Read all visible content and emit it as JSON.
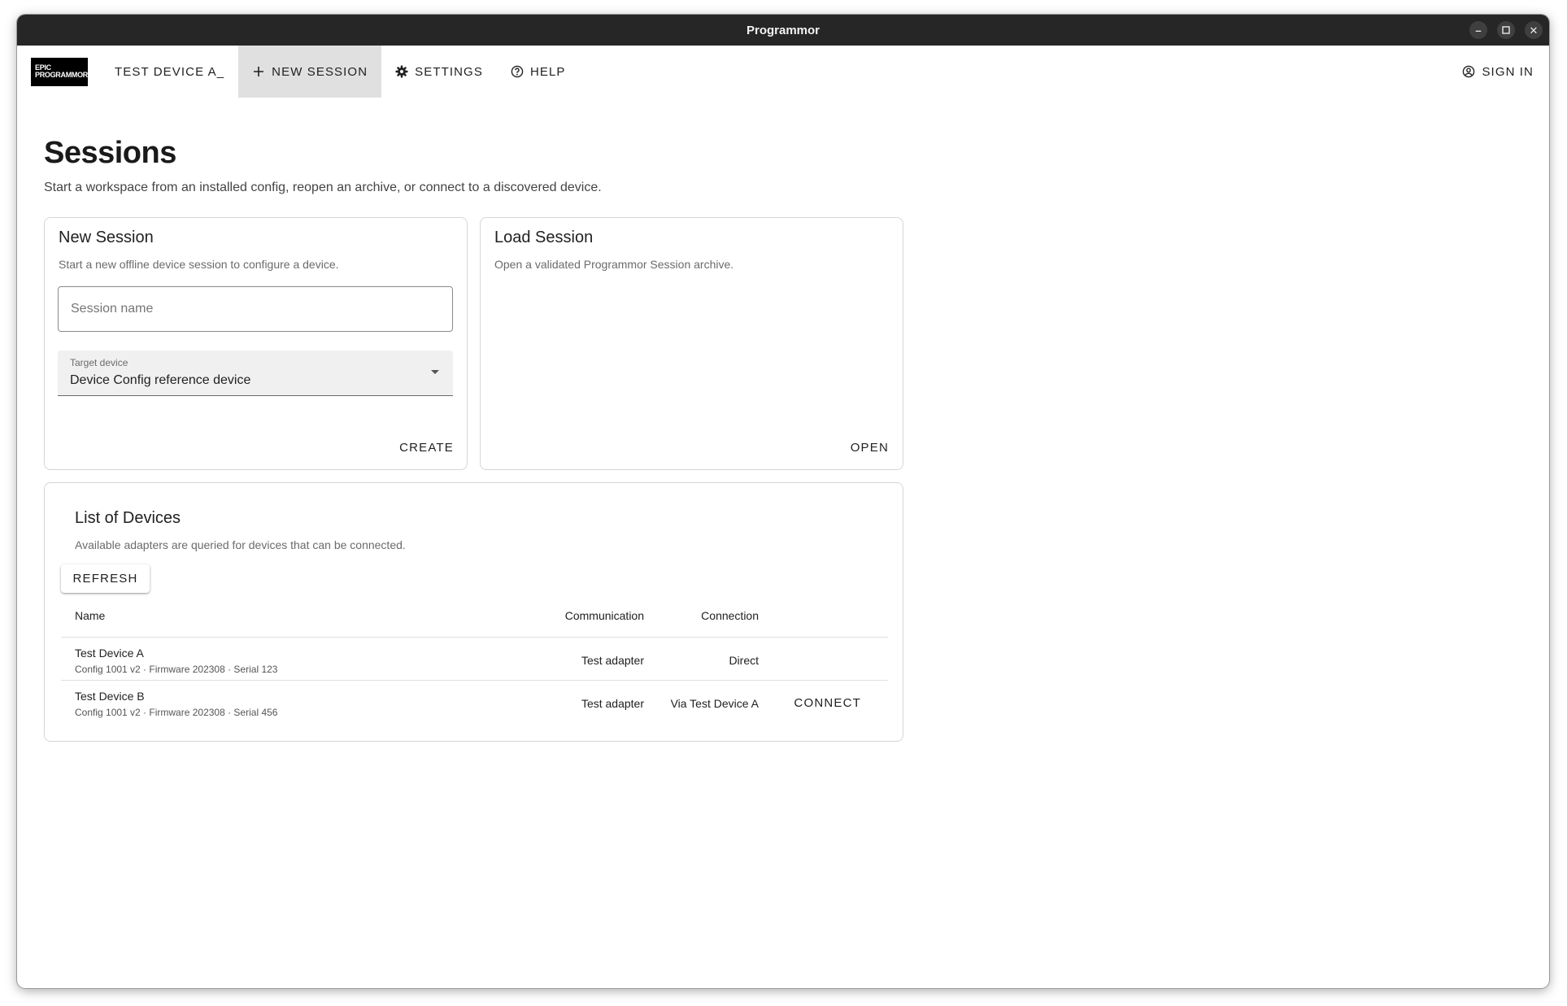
{
  "window": {
    "title": "Programmor"
  },
  "toolbar": {
    "logo_line1": "EPIC",
    "logo_line2": "PROGRAMMOR",
    "device_label": "TEST DEVICE A_",
    "new_session_label": "NEW SESSION",
    "settings_label": "SETTINGS",
    "help_label": "HELP",
    "sign_in_label": "SIGN IN"
  },
  "page": {
    "title": "Sessions",
    "subtitle": "Start a workspace from an installed config, reopen an archive, or connect to a discovered device."
  },
  "new_session": {
    "title": "New Session",
    "description": "Start a new offline device session to configure a device.",
    "name_placeholder": "Session name",
    "target_label": "Target device",
    "target_value": "Device Config reference device",
    "create_label": "CREATE"
  },
  "load_session": {
    "title": "Load Session",
    "description": "Open a validated Programmor Session archive.",
    "open_label": "OPEN"
  },
  "devices": {
    "title": "List of Devices",
    "description": "Available adapters are queried for devices that can be connected.",
    "refresh_label": "REFRESH",
    "columns": {
      "name": "Name",
      "communication": "Communication",
      "connection": "Connection"
    },
    "rows": [
      {
        "name": "Test Device A",
        "meta": "Config 1001 v2 · Firmware 202308 · Serial 123",
        "communication": "Test adapter",
        "connection": "Direct",
        "action": ""
      },
      {
        "name": "Test Device B",
        "meta": "Config 1001 v2 · Firmware 202308 · Serial 456",
        "communication": "Test adapter",
        "connection": "Via Test Device A",
        "action": "CONNECT"
      }
    ]
  }
}
